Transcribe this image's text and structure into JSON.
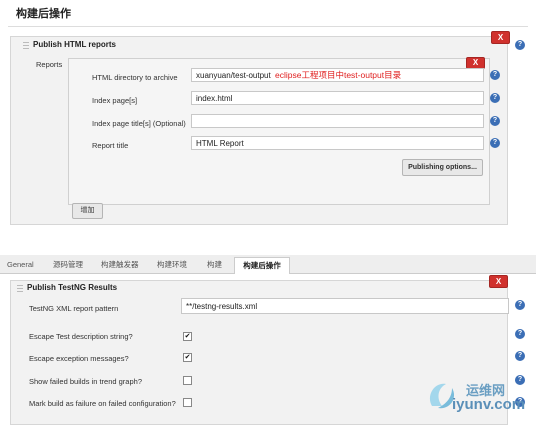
{
  "top": {
    "section_title": "构建后操作",
    "publish_html_title": "Publish HTML reports",
    "reports_label": "Reports",
    "fields": [
      {
        "label": "HTML directory to archive",
        "value": "xuanyuan/test-output"
      },
      {
        "label": "Index page[s]",
        "value": "index.html"
      },
      {
        "label": "Index page title[s] (Optional)",
        "value": ""
      },
      {
        "label": "Report title",
        "value": "HTML Report"
      }
    ],
    "annotation": "eclipse工程项目中test-output目录",
    "publishing_options": "Publishing options...",
    "add_button": "增加",
    "close": "X",
    "help": "?"
  },
  "tabs": [
    {
      "label": "General",
      "active": false
    },
    {
      "label": "源码管理",
      "active": false
    },
    {
      "label": "构建触发器",
      "active": false
    },
    {
      "label": "构建环境",
      "active": false
    },
    {
      "label": "构建",
      "active": false
    },
    {
      "label": "构建后操作",
      "active": true
    }
  ],
  "bottom": {
    "title": "Publish TestNG Results",
    "pattern_label": "TestNG XML report pattern",
    "pattern_value": "**/testng-results.xml",
    "options": [
      {
        "label": "Escape Test description string?",
        "checked": true,
        "mark": "✔"
      },
      {
        "label": "Escape exception messages?",
        "checked": true,
        "mark": "✔"
      },
      {
        "label": "Show failed builds in trend graph?",
        "checked": false,
        "mark": ""
      },
      {
        "label": "Mark build as failure on failed configuration?",
        "checked": false,
        "mark": ""
      }
    ],
    "close": "X",
    "help": "?"
  },
  "watermark": {
    "text": "运维网",
    "url": "iyunv.com"
  },
  "colors": {
    "close_red": "#d0312d",
    "help_blue": "#3b6eb5",
    "annotation_red": "#e02020"
  }
}
